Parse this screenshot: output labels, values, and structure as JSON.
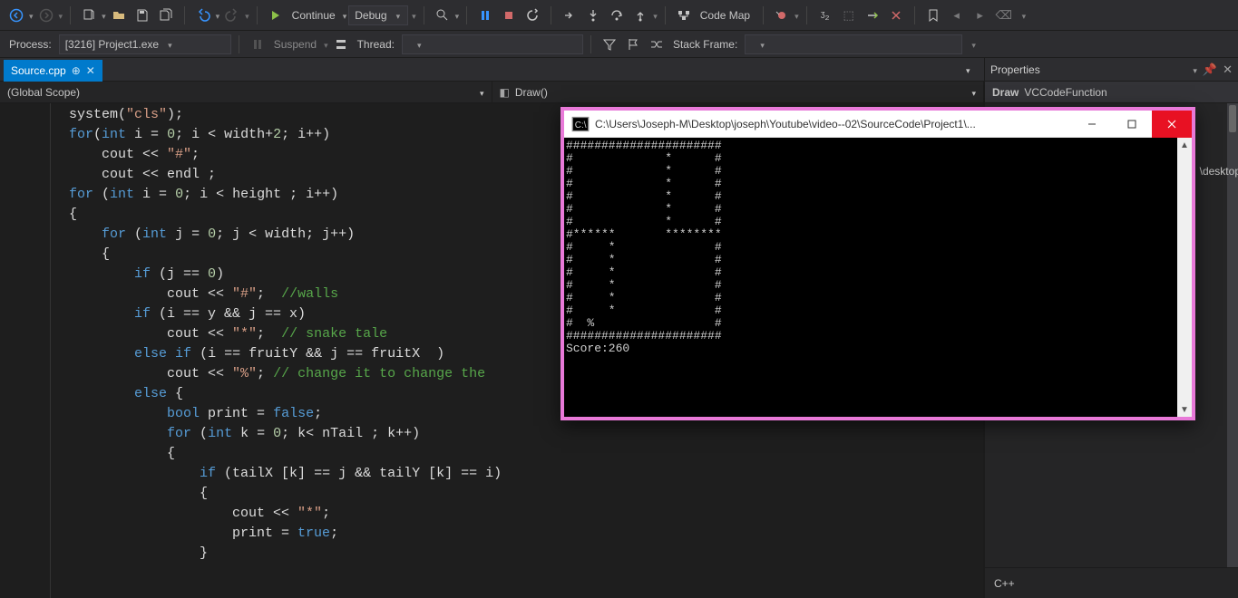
{
  "toolbar1": {
    "continue_label": "Continue",
    "config_label": "Debug",
    "codemap_label": "Code Map"
  },
  "toolbar2": {
    "process_label": "Process:",
    "process_value": "[3216] Project1.exe",
    "suspend_label": "Suspend",
    "thread_label": "Thread:",
    "stackframe_label": "Stack Frame:"
  },
  "tab": {
    "name": "Source.cpp"
  },
  "scope": {
    "left": "(Global Scope)",
    "right": "Draw()"
  },
  "code_lines": [
    "system(\"cls\");",
    "for(int i = 0; i < width+2; i++)",
    "    cout << \"#\";",
    "    cout << endl ;",
    "for (int i = 0; i < height ; i++)",
    "{",
    "    for (int j = 0; j < width; j++)",
    "    {",
    "        if (j == 0)",
    "            cout << \"#\";  //walls",
    "        if (i == y && j == x)",
    "            cout << \"*\";  // snake tale",
    "        else if (i == fruitY && j == fruitX  )",
    "            cout << \"%\"; // change it to change the",
    "        else {",
    "            bool print = false;",
    "            for (int k = 0; k< nTail ; k++)",
    "            {",
    "                if (tailX [k] == j && tailY [k] == i)",
    "                {",
    "                    cout << \"*\";",
    "                    print = true;",
    "                }"
  ],
  "console": {
    "title": "C:\\Users\\Joseph-M\\Desktop\\joseph\\Youtube\\video--02\\SourceCode\\Project1\\...",
    "lines": [
      "######################",
      "#             *      #",
      "#             *      #",
      "#             *      #",
      "#             *      #",
      "#             *      #",
      "#             *      #",
      "#******       ********",
      "#     *              #",
      "#     *              #",
      "#     *              #",
      "#     *              #",
      "#     *              #",
      "#     *              #",
      "#  %                 #",
      "######################",
      "Score:260"
    ]
  },
  "props": {
    "title": "Properties",
    "object_name": "Draw",
    "object_type": "VCCodeFunction",
    "side_label": "\\desktop",
    "footer": "C++"
  }
}
